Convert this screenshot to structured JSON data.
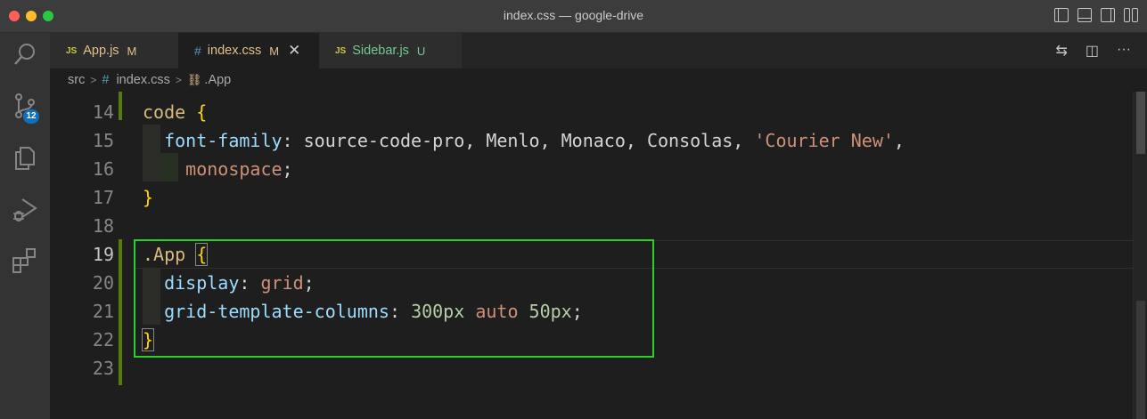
{
  "window": {
    "title": "index.css — google-drive"
  },
  "activity_bar": {
    "items": [
      "search-icon",
      "source-control-icon",
      "explorer-icon",
      "run-debug-icon",
      "extensions-icon"
    ],
    "source_control_badge": "12"
  },
  "tabs": [
    {
      "type_label": "JS",
      "name": "App.js",
      "status": "M",
      "active": false,
      "color": "#e2c08d"
    },
    {
      "type_label": "#",
      "name": "index.css",
      "status": "M",
      "active": true,
      "color": "#e2c08d"
    },
    {
      "type_label": "JS",
      "name": "Sidebar.js",
      "status": "U",
      "active": false,
      "color": "#73c991"
    }
  ],
  "breadcrumb": {
    "folder": "src",
    "file": "index.css",
    "symbol": ".App"
  },
  "editor": {
    "lines": [
      {
        "number": "14"
      },
      {
        "number": "15"
      },
      {
        "number": "16"
      },
      {
        "number": "17"
      },
      {
        "number": "18"
      },
      {
        "number": "19"
      },
      {
        "number": "20"
      },
      {
        "number": "21"
      },
      {
        "number": "22"
      },
      {
        "number": "23"
      }
    ],
    "tokens": {
      "l14_sel": "code",
      "l14_brace": "{",
      "l15_prop": "font-family",
      "l15_vals": "source-code-pro, Menlo, Monaco, Consolas, ",
      "l15_str": "'Courier New'",
      "l15_comma": ",",
      "l16_val": "monospace",
      "l16_semi": ";",
      "l17_brace": "}",
      "l19_sel": ".App",
      "l19_brace": "{",
      "l20_prop": "display",
      "l20_val": "grid",
      "l21_prop": "grid-template-columns",
      "l21_v1": "300px",
      "l21_v2": "auto",
      "l21_v3": "50px",
      "l22_brace": "}"
    },
    "current_line": "19"
  },
  "colors": {
    "highlight_box": "#2bd12b",
    "modified": "#e2c08d",
    "untracked": "#73c991"
  }
}
